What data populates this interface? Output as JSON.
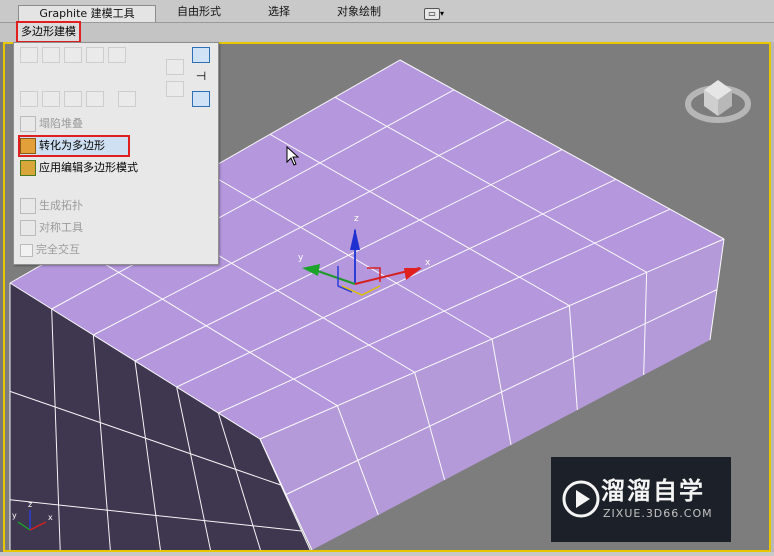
{
  "ribbon": {
    "tabs": [
      {
        "label": "Graphite 建模工具",
        "active": true
      },
      {
        "label": "自由形式"
      },
      {
        "label": "选择"
      },
      {
        "label": "对象绘制"
      }
    ],
    "sub_title": "多边形建模"
  },
  "panel": {
    "items": [
      {
        "label": "塌陷堆叠",
        "enabled": false
      },
      {
        "label": "转化为多边形",
        "enabled": true,
        "highlighted": true
      },
      {
        "label": "应用编辑多边形模式",
        "enabled": true
      },
      {
        "label": "生成拓扑",
        "enabled": false
      },
      {
        "label": "对称工具",
        "enabled": false
      },
      {
        "label": "完全交互",
        "enabled": false
      }
    ]
  },
  "gizmo": {
    "z_label": "z",
    "y_label": "y",
    "x_label": "x"
  },
  "corner_axes": {
    "z_label": "z",
    "y_label": "y",
    "x_label": "x"
  },
  "watermark": {
    "name": "溜溜自学",
    "url": "ZIXUE.3D66.COM"
  },
  "colors": {
    "box_top": "#b497dc",
    "box_side": "#4a3f5c",
    "viewport_border": "#e6c700",
    "highlight": "#e02020"
  }
}
